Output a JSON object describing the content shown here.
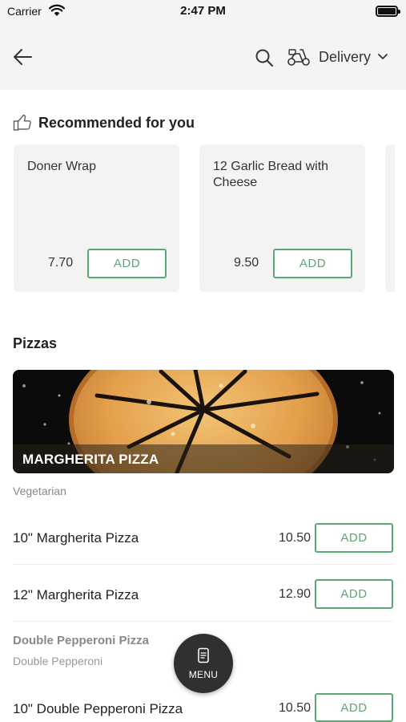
{
  "status_bar": {
    "carrier": "Carrier",
    "time": "2:47 PM"
  },
  "header": {
    "order_type": "Delivery",
    "icons": [
      "back-arrow-icon",
      "search-icon",
      "scooter-icon",
      "chevron-down-icon"
    ]
  },
  "recommended": {
    "title": "Recommended for you",
    "items": [
      {
        "name": "Doner Wrap",
        "price": "7.70",
        "button": "ADD"
      },
      {
        "name": "12 Garlic Bread with Cheese",
        "price": "9.50",
        "button": "ADD"
      }
    ]
  },
  "category": {
    "title": "Pizzas",
    "banner_title": "MARGHERITA PIZZA",
    "description": "Vegetarian",
    "items": [
      {
        "name": "10\" Margherita Pizza",
        "price": "10.50",
        "button": "ADD"
      },
      {
        "name": "12\" Margherita Pizza",
        "price": "12.90",
        "button": "ADD"
      }
    ]
  },
  "next_group": {
    "title": "Double Pepperoni Pizza",
    "subtitle": "Double Pepperoni",
    "items": [
      {
        "name": "10\" Double Pepperoni Pizza",
        "price": "10.50",
        "button": "ADD"
      }
    ]
  },
  "fab": {
    "label": "MENU"
  },
  "colors": {
    "accent": "#5aa873",
    "header_bg": "#f4f4f4",
    "card_bg": "#f3f3f3",
    "fab_bg": "#303030"
  }
}
